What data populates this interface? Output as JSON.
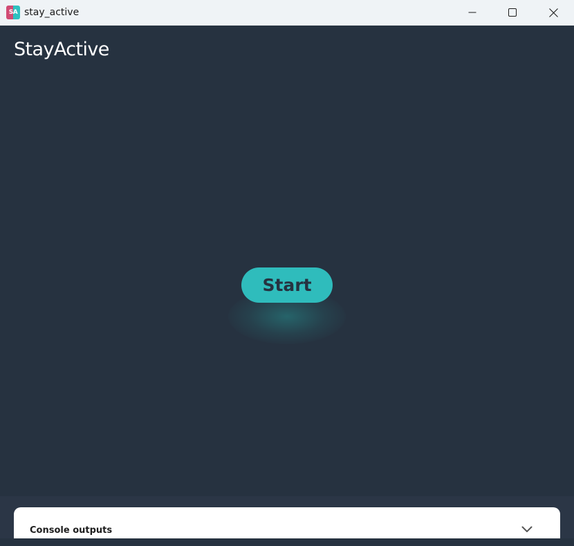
{
  "window": {
    "title": "stay_active",
    "icon_text": "SA",
    "icon_colors": [
      "#d14b74",
      "#2ec1c0"
    ]
  },
  "app": {
    "heading": "StayActive",
    "background": "#263240",
    "accent": "#2fbcbc"
  },
  "main": {
    "start_label": "Start"
  },
  "console": {
    "label": "Console outputs",
    "toggle_icon": "chevron-down-icon"
  },
  "icons": {
    "minimize": "minimize-icon",
    "maximize": "maximize-icon",
    "close": "close-icon"
  }
}
